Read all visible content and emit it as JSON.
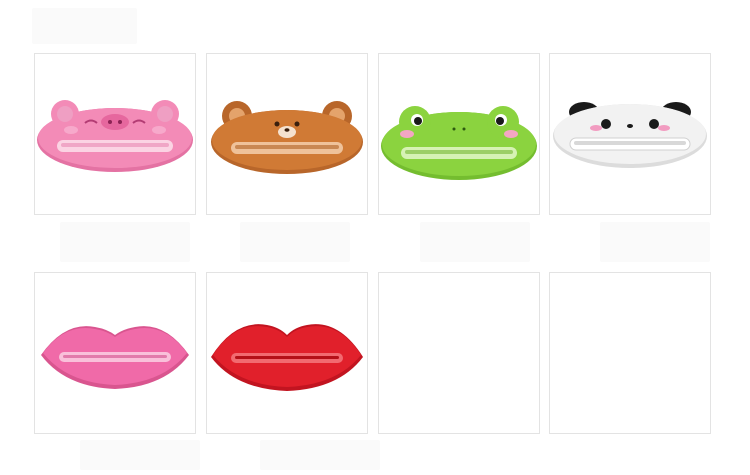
{
  "gallery": {
    "items": [
      {
        "kind": "pig",
        "body": "#f38bb7",
        "shade": "#e472a3",
        "slot": "#fbd3e3"
      },
      {
        "kind": "bear",
        "body": "#d07a35",
        "shade": "#b8662a",
        "slot": "#efc29a"
      },
      {
        "kind": "frog",
        "body": "#8bd33f",
        "shade": "#74bd2f",
        "slot": "#d6f2b4"
      },
      {
        "kind": "panda",
        "body": "#f2f2f2",
        "shade": "#dcdcdc",
        "slot": "#ffffff"
      },
      {
        "kind": "lips",
        "body": "#f06aa8",
        "shade": "#d9558f",
        "slot": "#f9c0da"
      },
      {
        "kind": "lips",
        "body": "#e1202b",
        "shade": "#c21420",
        "slot": "#f26a70"
      },
      {
        "kind": "empty"
      },
      {
        "kind": "empty"
      }
    ]
  }
}
